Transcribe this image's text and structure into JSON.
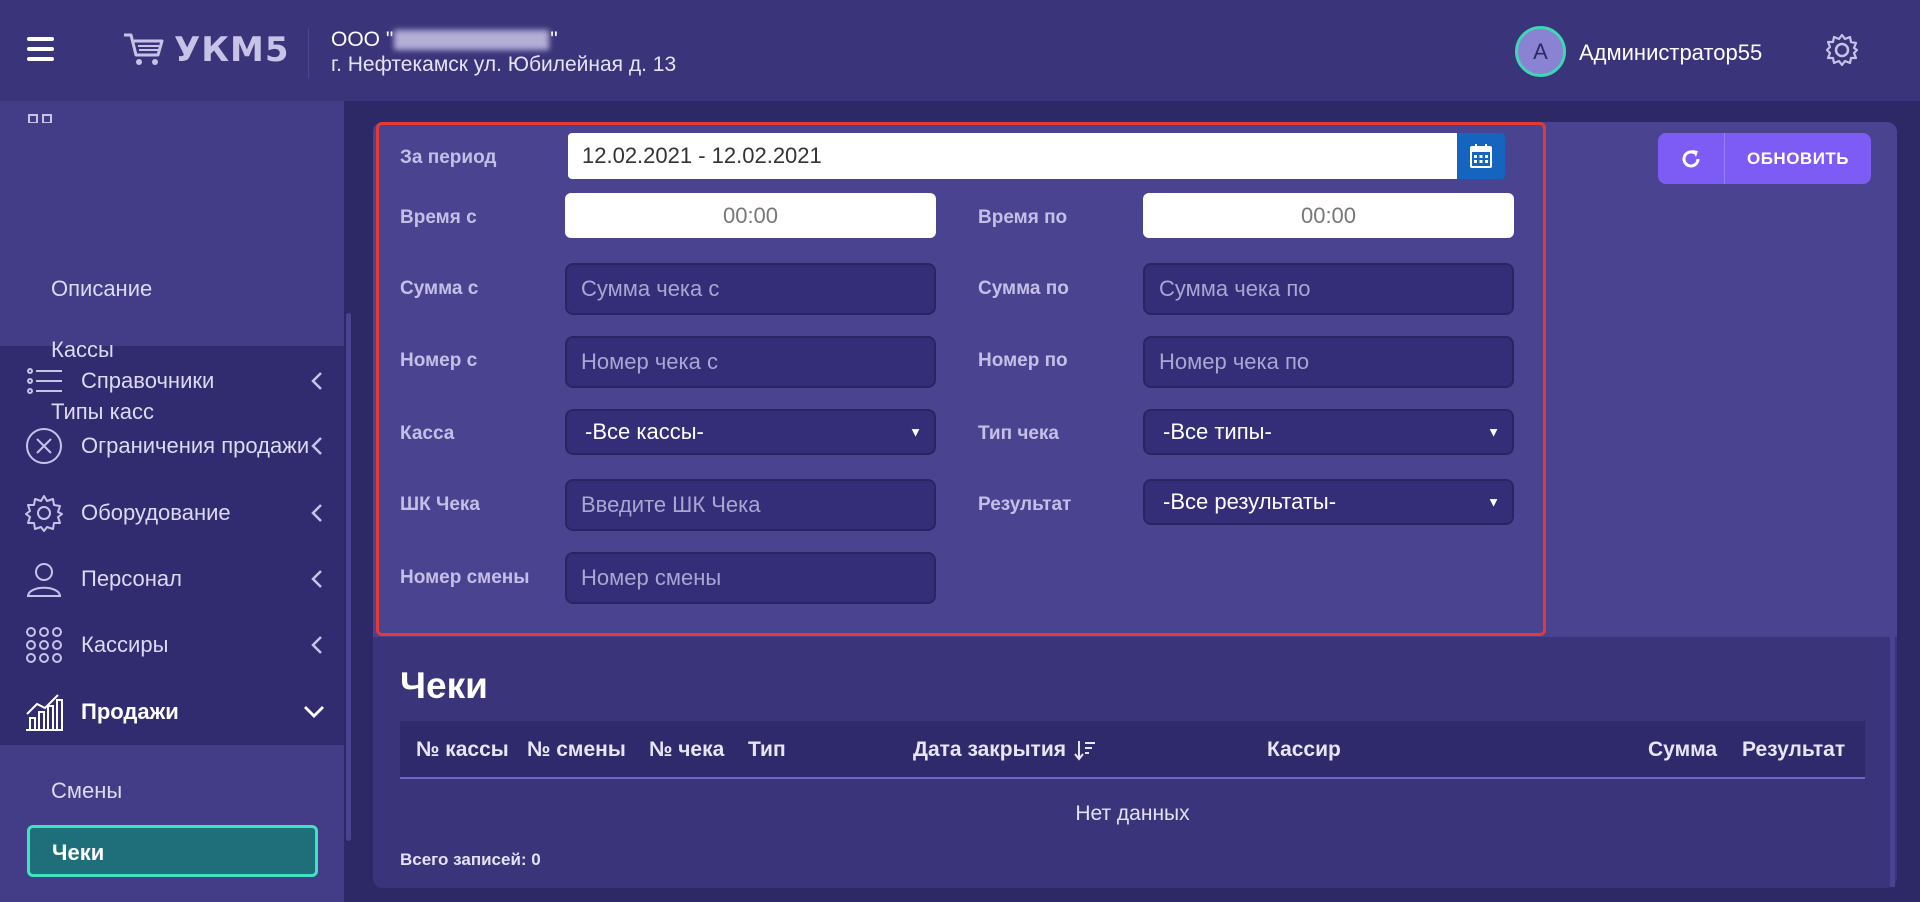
{
  "header": {
    "logo_text": "УКМ5",
    "org_prefix": "ООО \"",
    "org_suffix": "\"",
    "org_address": "г. Нефтекамск ул. Юбилейная д. 13",
    "avatar_letter": "А",
    "user_name": "Администратор55"
  },
  "sidebar": {
    "top_subitems": [
      "Описание",
      "Кассы",
      "Типы касс"
    ],
    "items": [
      {
        "label": "Справочники",
        "icon": "list-icon"
      },
      {
        "label": "Ограничения продажи",
        "icon": "close-circle-icon"
      },
      {
        "label": "Оборудование",
        "icon": "gear-icon"
      },
      {
        "label": "Персонал",
        "icon": "user-icon"
      },
      {
        "label": "Кассиры",
        "icon": "grid-dots-icon"
      },
      {
        "label": "Продажи",
        "icon": "chart-icon"
      }
    ],
    "sales_subitems": [
      "Смены",
      "Чеки"
    ]
  },
  "filters": {
    "period_label": "За период",
    "period_value": "12.02.2021 - 12.02.2021",
    "time_from_label": "Время с",
    "time_from_value": "00:00",
    "time_to_label": "Время по",
    "time_to_value": "00:00",
    "sum_from_label": "Сумма с",
    "sum_from_placeholder": "Сумма чека с",
    "sum_to_label": "Сумма по",
    "sum_to_placeholder": "Сумма чека по",
    "num_from_label": "Номер с",
    "num_from_placeholder": "Номер чека с",
    "num_to_label": "Номер по",
    "num_to_placeholder": "Номер чека по",
    "kassa_label": "Касса",
    "kassa_value": "-Все кассы-",
    "check_type_label": "Тип чека",
    "check_type_value": "-Все типы-",
    "barcode_label": "ШК Чека",
    "barcode_placeholder": "Введите ШК Чека",
    "result_label": "Результат",
    "result_value": "-Все результаты-",
    "shift_label": "Номер смены",
    "shift_placeholder": "Номер смены",
    "refresh_label": "ОБНОВИТЬ"
  },
  "table": {
    "title": "Чеки",
    "columns": [
      "№ кассы",
      "№ смены",
      "№ чека",
      "Тип",
      "Дата закрытия",
      "Кассир",
      "Сумма",
      "Результат"
    ],
    "empty_text": "Нет данных",
    "total_text": "Всего записей: 0"
  },
  "colors": {
    "accent": "#7c5cf5",
    "highlight": "#e53935",
    "active_item": "#1f6f7b"
  }
}
